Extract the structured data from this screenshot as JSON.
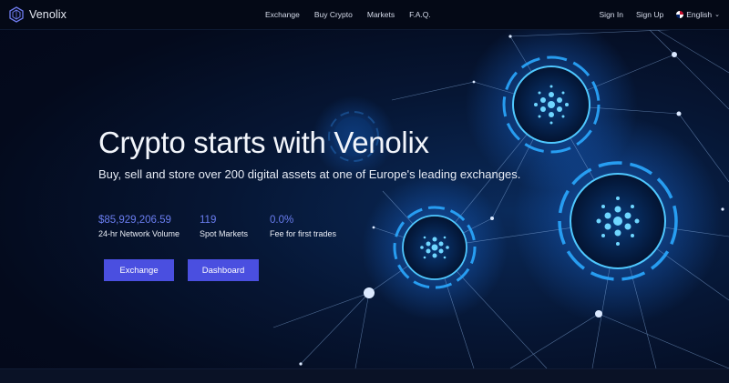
{
  "brand": {
    "name": "Venolix"
  },
  "nav": {
    "links": [
      "Exchange",
      "Buy Crypto",
      "Markets",
      "F.A.Q."
    ],
    "sign_in": "Sign In",
    "sign_up": "Sign Up",
    "language": "English"
  },
  "hero": {
    "title": "Crypto starts with Venolix",
    "subtitle": "Buy, sell and store over 200 digital assets at one of Europe's leading exchanges."
  },
  "stats": [
    {
      "value": "$85,929,206.59",
      "label": "24-hr Network Volume"
    },
    {
      "value": "119",
      "label": "Spot Markets"
    },
    {
      "value": "0.0%",
      "label": "Fee for first trades"
    }
  ],
  "buttons": {
    "exchange": "Exchange",
    "dashboard": "Dashboard"
  },
  "colors": {
    "accent": "#4a4fe0",
    "stat_value": "#6a7df0",
    "background": "#050a18",
    "glow": "#39c6ff"
  },
  "icons": {
    "logo": "venolix-hexagon-logo",
    "language": "uk-flag-icon",
    "chevron": "chevron-down-icon",
    "network_node": "cardano-coin-icon"
  }
}
